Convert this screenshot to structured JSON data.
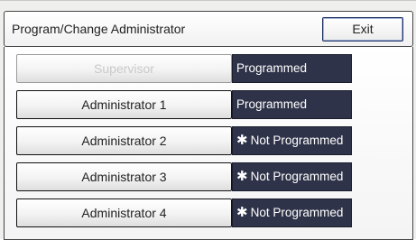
{
  "header": {
    "title": "Program/Change Administrator",
    "exit_label": "Exit"
  },
  "rows": [
    {
      "label": "Supervisor",
      "enabled": false,
      "status_mark": "",
      "status": "Programmed"
    },
    {
      "label": "Administrator 1",
      "enabled": true,
      "status_mark": "",
      "status": "Programmed"
    },
    {
      "label": "Administrator 2",
      "enabled": true,
      "status_mark": "✱",
      "status": "Not Programmed"
    },
    {
      "label": "Administrator 3",
      "enabled": true,
      "status_mark": "✱",
      "status": "Not Programmed"
    },
    {
      "label": "Administrator 4",
      "enabled": true,
      "status_mark": "✱",
      "status": "Not Programmed"
    }
  ],
  "colors": {
    "status_background": "#2f3349",
    "status_text": "#ffffff",
    "exit_border": "#1d2f63"
  }
}
